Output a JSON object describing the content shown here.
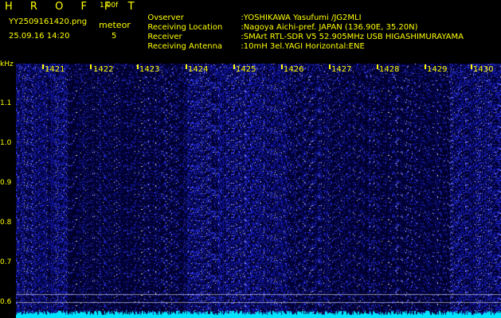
{
  "header": {
    "title": "H R O F F T",
    "version": "1.00f",
    "filename": "YY2509161420.png",
    "datetime": "25.09.16 14:20",
    "meteor_label": "meteor",
    "meteor_count": "5"
  },
  "station": {
    "rows": [
      {
        "label": "Ovserver",
        "value": ":YOSHIKAWA Yasufumi /JG2MLI"
      },
      {
        "label": "Receiving Location",
        "value": ":Nagoya Aichi-pref. JAPAN (136.90E, 35.20N)"
      },
      {
        "label": "Receiver",
        "value": ":SMArt RTL-SDR V5 52.905MHz USB HIGASHIMURAYAMA"
      },
      {
        "label": "Receiving Antenna",
        "value": ":10mH 3el.YAGI Horizontal:ENE"
      }
    ]
  },
  "axes": {
    "y_unit": "kHz",
    "y_ticks": [
      "1.1",
      "1.0",
      "0.9",
      "0.8",
      "0.7",
      "0.6"
    ],
    "x_ticks": [
      "1421",
      "1422",
      "1423",
      "1424",
      "1425",
      "1426",
      "1427",
      "1428",
      "1429",
      "1430"
    ]
  },
  "colors": {
    "text": "#ffff00",
    "background": "#000000",
    "noise": "#3a3aff",
    "baseline": "#00e5ff"
  }
}
